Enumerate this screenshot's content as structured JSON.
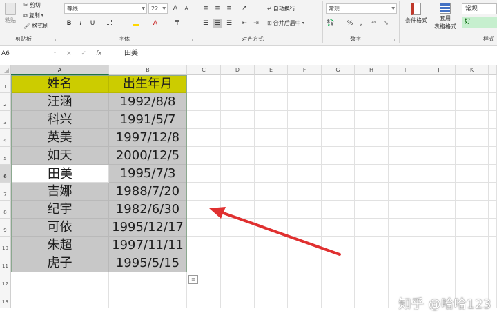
{
  "ribbon": {
    "clipboard": {
      "paste_label": "粘贴",
      "cut_label": "剪切",
      "copy_label": "复制",
      "format_painter_label": "格式刷",
      "group_label": "剪贴板"
    },
    "font": {
      "font_name": "等线",
      "font_size": "22",
      "grow_icon": "A",
      "shrink_icon": "A",
      "bold": "B",
      "italic": "I",
      "underline": "U",
      "color_letter": "A",
      "group_label": "字体"
    },
    "alignment": {
      "wrap_label": "自动换行",
      "merge_label": "合并后居中",
      "group_label": "对齐方式"
    },
    "number": {
      "format_value": "常规",
      "percent": "%",
      "comma": ",",
      "group_label": "数字"
    },
    "styles": {
      "conditional_label": "条件格式",
      "table_label": "套用",
      "table_label2": "表格格式",
      "normal_label": "常规",
      "good_label": "好",
      "group_label": "样式"
    }
  },
  "formula_bar": {
    "name_box": "A6",
    "cancel": "×",
    "enter": "✓",
    "fx": "fx",
    "content": "田美"
  },
  "sheet": {
    "columns": [
      "A",
      "B",
      "C",
      "D",
      "E",
      "F",
      "G",
      "H",
      "I",
      "J",
      "K"
    ],
    "rows": [
      "1",
      "2",
      "3",
      "4",
      "5",
      "6",
      "7",
      "8",
      "9",
      "10",
      "11",
      "12",
      "13"
    ],
    "headers": [
      "姓名",
      "出生年月"
    ],
    "data": [
      [
        "汪涵",
        "1992/8/8"
      ],
      [
        "科兴",
        "1991/5/7"
      ],
      [
        "英美",
        "1997/12/8"
      ],
      [
        "如天",
        "2000/12/5"
      ],
      [
        "田美",
        "1995/7/3"
      ],
      [
        "吉娜",
        "1988/7/20"
      ],
      [
        "纪宇",
        "1982/6/30"
      ],
      [
        "可依",
        "1995/12/17"
      ],
      [
        "朱超",
        "1997/11/11"
      ],
      [
        "虎子",
        "1995/5/15"
      ]
    ]
  },
  "watermark": "知乎 @哈哈123",
  "colors": {
    "header_fill": "#cccc00",
    "data_fill": "#c8c8c8",
    "arrow": "#e03030",
    "excel_green": "#217346"
  },
  "icons": [
    "paste-icon",
    "cut-icon",
    "copy-icon",
    "format-painter-icon",
    "bold-icon",
    "italic-icon",
    "underline-icon",
    "fill-color-icon",
    "font-color-icon",
    "wrap-text-icon",
    "merge-center-icon",
    "conditional-format-icon",
    "table-format-icon",
    "quick-analysis-icon"
  ]
}
